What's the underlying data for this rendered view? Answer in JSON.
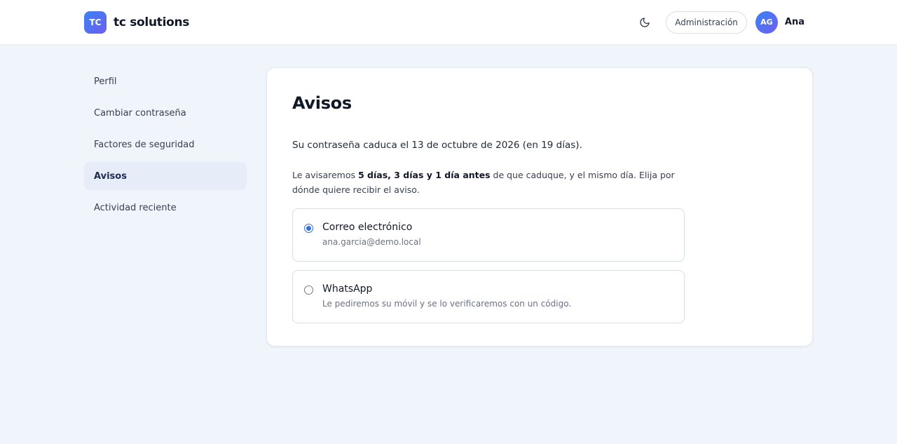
{
  "header": {
    "logo_text": "TC",
    "brand_name": "tc solutions",
    "admin_label": "Administración",
    "avatar_initials": "AG",
    "user_name": "Ana"
  },
  "sidebar": {
    "items": [
      {
        "label": "Perfil",
        "active": false
      },
      {
        "label": "Cambiar contraseña",
        "active": false
      },
      {
        "label": "Factores de seguridad",
        "active": false
      },
      {
        "label": "Avisos",
        "active": true
      },
      {
        "label": "Actividad reciente",
        "active": false
      }
    ]
  },
  "main": {
    "title": "Avisos",
    "expiry_text": "Su contraseña caduca el 13 de octubre de 2026 (en 19 días).",
    "notice_prefix": "Le avisaremos ",
    "notice_bold": "5 días, 3 días y 1 día antes",
    "notice_suffix": " de que caduque, y el mismo día. Elija por dónde quiere recibir el aviso.",
    "options": [
      {
        "title": "Correo electrónico",
        "subtitle": "ana.garcia@demo.local",
        "selected": true
      },
      {
        "title": "WhatsApp",
        "subtitle": "Le pediremos su móvil y se lo verificaremos con un código.",
        "selected": false
      }
    ]
  },
  "colors": {
    "accent": "#2f6fe0",
    "brand_gradient_start": "#3b82f6",
    "brand_gradient_end": "#6d5ef0",
    "page_background": "#f0f4fb",
    "active_nav_background": "#e6ecf8"
  },
  "icons": {
    "theme_toggle": "moon-icon"
  }
}
